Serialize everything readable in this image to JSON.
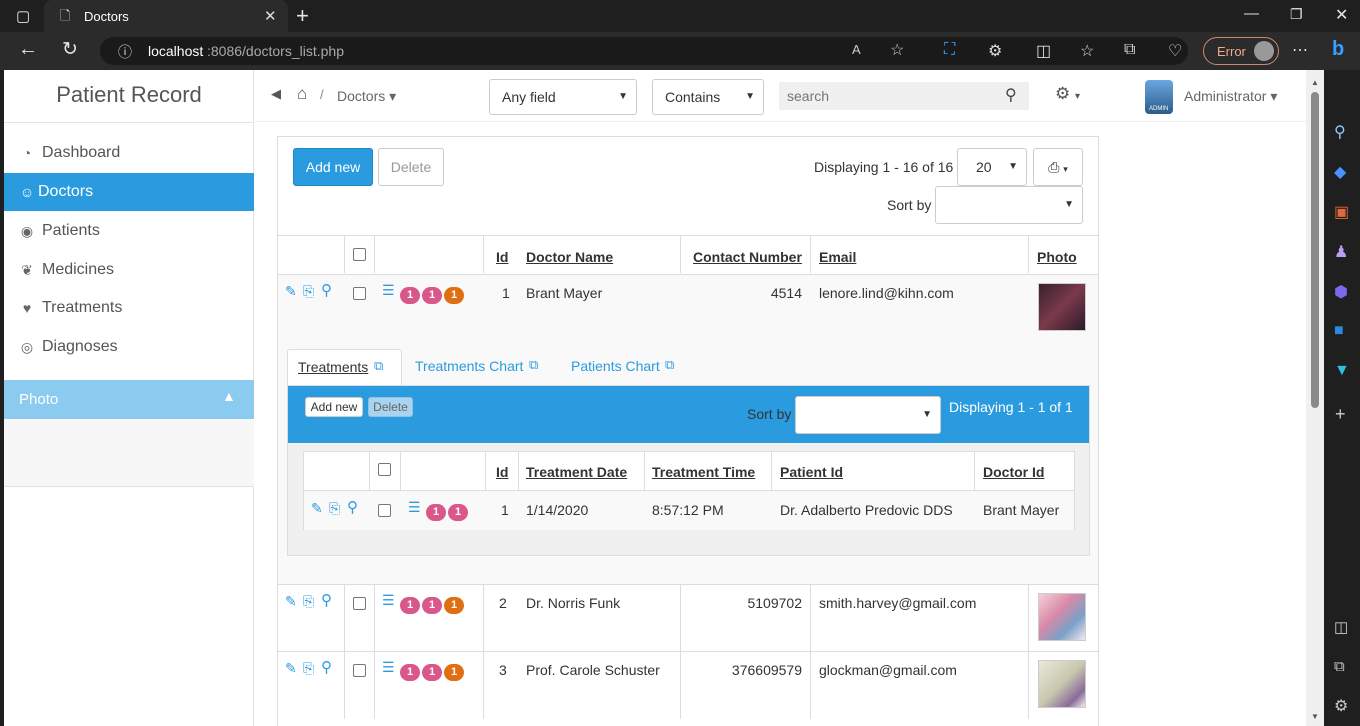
{
  "browser": {
    "tab_title": "Doctors",
    "url_host": "localhost",
    "url_rest": ":8086/doctors_list.php",
    "error_label": "Error"
  },
  "sidebar": {
    "title": "Patient Record",
    "items": [
      {
        "label": "Dashboard",
        "icon": "dashboard-icon"
      },
      {
        "label": "Doctors",
        "icon": "user-md-icon"
      },
      {
        "label": "Patients",
        "icon": "user-circle-icon"
      },
      {
        "label": "Medicines",
        "icon": "leaf-icon"
      },
      {
        "label": "Treatments",
        "icon": "heart-icon"
      },
      {
        "label": "Diagnoses",
        "icon": "eye-icon"
      }
    ],
    "photo_section_label": "Photo"
  },
  "topbar": {
    "breadcrumb": "Doctors",
    "field_select": "Any field",
    "match_select": "Contains",
    "search_placeholder": "search",
    "user": "Administrator",
    "avatar_caption": "ADMIN"
  },
  "toolbar": {
    "add_new": "Add new",
    "delete": "Delete",
    "displaying": "Displaying 1 - 16 of 16",
    "page_size": "20",
    "sort_by": "Sort by"
  },
  "table": {
    "headers": [
      "Id",
      "Doctor Name",
      "Contact Number",
      "Email",
      "Photo"
    ],
    "rows": [
      {
        "id": "1",
        "name": "Brant Mayer",
        "contact": "4514",
        "email": "lenore.lind@kihn.com",
        "badges": [
          "1",
          "1",
          "1"
        ]
      },
      {
        "id": "2",
        "name": "Dr. Norris Funk",
        "contact": "5109702",
        "email": "smith.harvey@gmail.com",
        "badges": [
          "1",
          "1",
          "1"
        ]
      },
      {
        "id": "3",
        "name": "Prof. Carole Schuster",
        "contact": "376609579",
        "email": "glockman@gmail.com",
        "badges": [
          "1",
          "1",
          "1"
        ]
      }
    ]
  },
  "detail": {
    "tabs": [
      "Treatments",
      "Treatments Chart",
      "Patients Chart"
    ],
    "add_new": "Add new",
    "delete": "Delete",
    "sort_by": "Sort by",
    "displaying": "Displaying 1 - 1 of 1",
    "headers": [
      "Id",
      "Treatment Date",
      "Treatment Time",
      "Patient Id",
      "Doctor Id"
    ],
    "rows": [
      {
        "id": "1",
        "date": "1/14/2020",
        "time": "8:57:12 PM",
        "patient": "Dr. Adalberto Predovic DDS",
        "doctor": "Brant Mayer",
        "badges": [
          "1",
          "1"
        ]
      }
    ]
  },
  "colors": {
    "accent": "#2b9be0",
    "badge_pink": "#d9578a",
    "badge_orange": "#e06f14"
  }
}
